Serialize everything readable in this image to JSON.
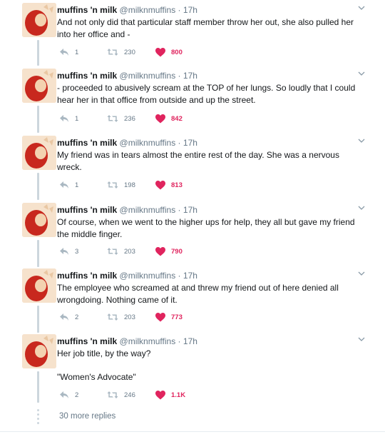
{
  "tweets": [
    {
      "name": "muffins 'n milk",
      "handle": "@milknmuffins",
      "separator": "·",
      "time": "17h",
      "text": [
        "And not only did that particular staff member throw her out, she also pulled her into her office and -"
      ],
      "replies": "1",
      "retweets": "230",
      "likes": "800"
    },
    {
      "name": "muffins 'n milk",
      "handle": "@milknmuffins",
      "separator": "·",
      "time": "17h",
      "text": [
        "- proceeded to abusively scream at the TOP of her lungs. So loudly that I could hear her in that office from outside and up the street."
      ],
      "replies": "1",
      "retweets": "236",
      "likes": "842"
    },
    {
      "name": "muffins 'n milk",
      "handle": "@milknmuffins",
      "separator": "·",
      "time": "17h",
      "text": [
        "My friend was in tears almost the entire rest of the day. She was a nervous wreck."
      ],
      "replies": "1",
      "retweets": "198",
      "likes": "813"
    },
    {
      "name": "muffins 'n milk",
      "handle": "@milknmuffins",
      "separator": "·",
      "time": "17h",
      "text": [
        "Of course, when we went to the higher ups for help, they all but gave my friend the middle finger."
      ],
      "replies": "3",
      "retweets": "203",
      "likes": "790"
    },
    {
      "name": "muffins 'n milk",
      "handle": "@milknmuffins",
      "separator": "·",
      "time": "17h",
      "text": [
        "The employee who screamed at and threw my friend out of here denied all wrongdoing. Nothing came of it."
      ],
      "replies": "2",
      "retweets": "203",
      "likes": "773"
    },
    {
      "name": "muffins 'n milk",
      "handle": "@milknmuffins",
      "separator": "·",
      "time": "17h",
      "text": [
        "Her job title, by the way?",
        "\"Women's Advocate\""
      ],
      "replies": "2",
      "retweets": "246",
      "likes": "1.1K"
    }
  ],
  "more_replies": "30 more replies",
  "colors": {
    "like": "#e0245e",
    "muted": "#657786",
    "text": "#14171a",
    "thread_line": "#ccd6dd",
    "avatar_hair": "#c8281e"
  },
  "icons": {
    "reply": "reply-arrow-icon",
    "retweet": "retweet-icon",
    "like": "heart-icon",
    "menu": "chevron-down-icon"
  }
}
